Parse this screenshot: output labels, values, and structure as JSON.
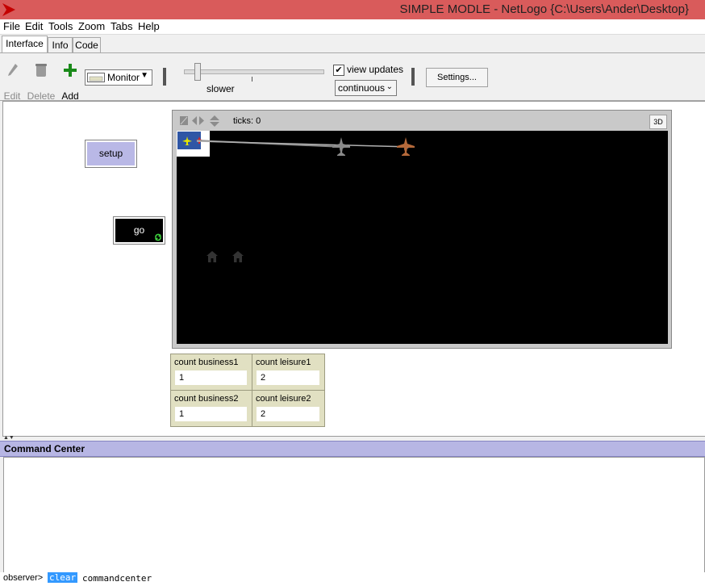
{
  "window": {
    "title": "SIMPLE MODLE - NetLogo {C:\\Users\\Ander\\Desktop}"
  },
  "menu": [
    "File",
    "Edit",
    "Tools",
    "Zoom",
    "Tabs",
    "Help"
  ],
  "tabs": [
    "Interface",
    "Info",
    "Code"
  ],
  "toolbar": {
    "edit": "Edit",
    "delete": "Delete",
    "add": "Add",
    "widget_type": "Monitor",
    "speed_label": "slower",
    "view_updates": "view updates",
    "update_mode": "continuous",
    "settings": "Settings..."
  },
  "widgets": {
    "setup": "setup",
    "go": "go"
  },
  "view": {
    "ticks_label": "ticks: 0",
    "three_d": "3D"
  },
  "monitors": [
    {
      "label": "count business1",
      "value": "1"
    },
    {
      "label": "count leisure1",
      "value": "2"
    },
    {
      "label": "count business2",
      "value": "1"
    },
    {
      "label": "count leisure2",
      "value": "2"
    }
  ],
  "command_center": {
    "title": "Command Center",
    "prompt": "observer>",
    "clear": "clear",
    "input": "commandcenter"
  },
  "colors": {
    "title_bar": "#d95b5b",
    "button_bg": "#b9b8e6",
    "monitor_bg": "#e1e0c2",
    "plane_grey": "#8a8a8a",
    "plane_orange": "#b5693a"
  }
}
